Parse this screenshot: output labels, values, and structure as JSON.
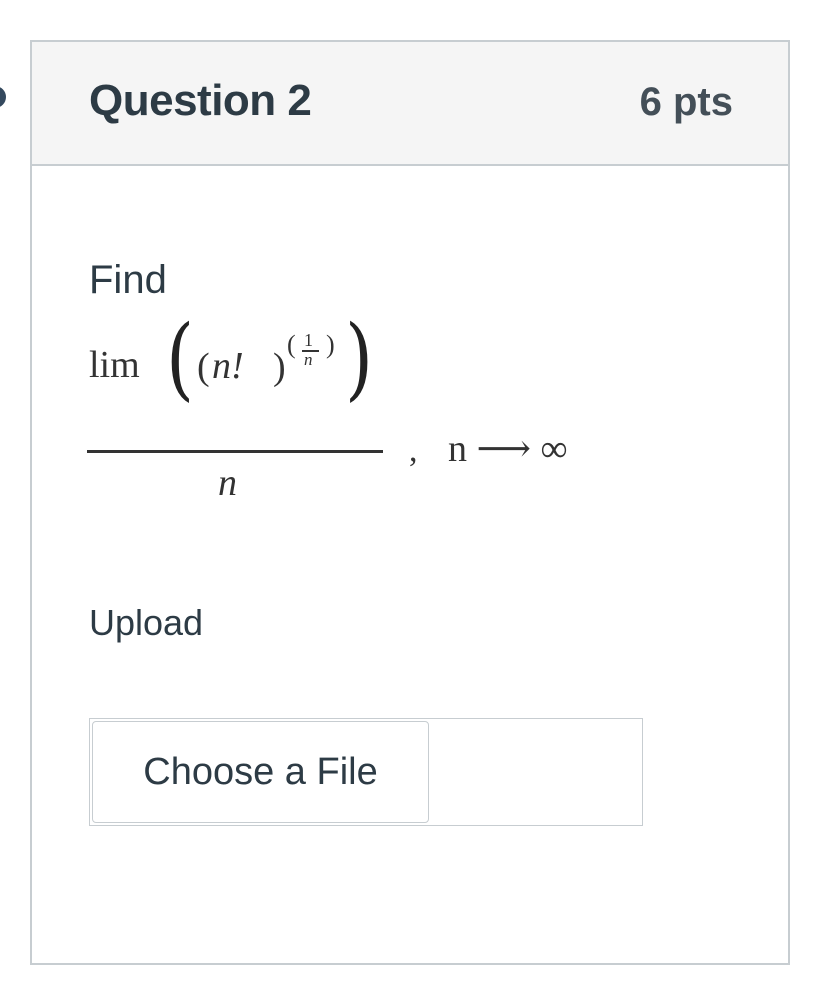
{
  "question": {
    "title": "Question 2",
    "points": "6 pts"
  },
  "prompt": {
    "find_label": "Find",
    "formula": {
      "operator": "lim",
      "inner_open": "(",
      "factorial_term": "n!",
      "inner_close": ")",
      "exponent_numerator": "1",
      "exponent_denominator": "n",
      "denominator": "n",
      "comma": ",",
      "condition": "n ⟶ ∞"
    }
  },
  "upload": {
    "label": "Upload",
    "button_label": "Choose a File"
  },
  "icons": {
    "left_marker": "bookmark-marker-icon"
  }
}
